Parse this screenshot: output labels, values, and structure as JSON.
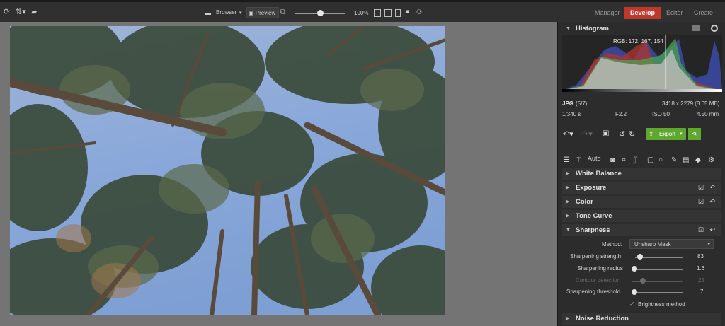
{
  "toolbar": {
    "browser_label": "Browser",
    "preview_label": "Preview",
    "zoom_label": "100%",
    "modes": [
      "Manager",
      "Develop",
      "Editor",
      "Create"
    ]
  },
  "histogram": {
    "title": "Histogram",
    "rgb_readout": "RGB: 172, 167, 154"
  },
  "file_info": {
    "format": "JPG",
    "index": "(5/7)",
    "dimensions": "3418 x 2279 (8.65 MB)",
    "shutter": "1/340 s",
    "aperture": "F2.2",
    "iso": "ISO 50",
    "focal": "4.50 mm"
  },
  "actions": {
    "export_label": "Export"
  },
  "tools": {
    "auto_label": "Auto"
  },
  "sections": {
    "white_balance": "White Balance",
    "exposure": "Exposure",
    "color": "Color",
    "tone_curve": "Tone Curve",
    "sharpness": "Sharpness",
    "noise_reduction": "Noise Reduction"
  },
  "sharpness": {
    "method_label": "Method:",
    "method_value": "Unsharp Mask",
    "strength_label": "Sharpening strength",
    "strength_value": "83",
    "radius_label": "Sharpening radius",
    "radius_value": "1.6",
    "contour_label": "Contour detection",
    "contour_value": "25",
    "threshold_label": "Sharpening threshold",
    "threshold_value": "7",
    "brightness_label": "Brightness method"
  },
  "colors": {
    "accent_develop": "#c0382b",
    "export_green": "#5fa830"
  }
}
